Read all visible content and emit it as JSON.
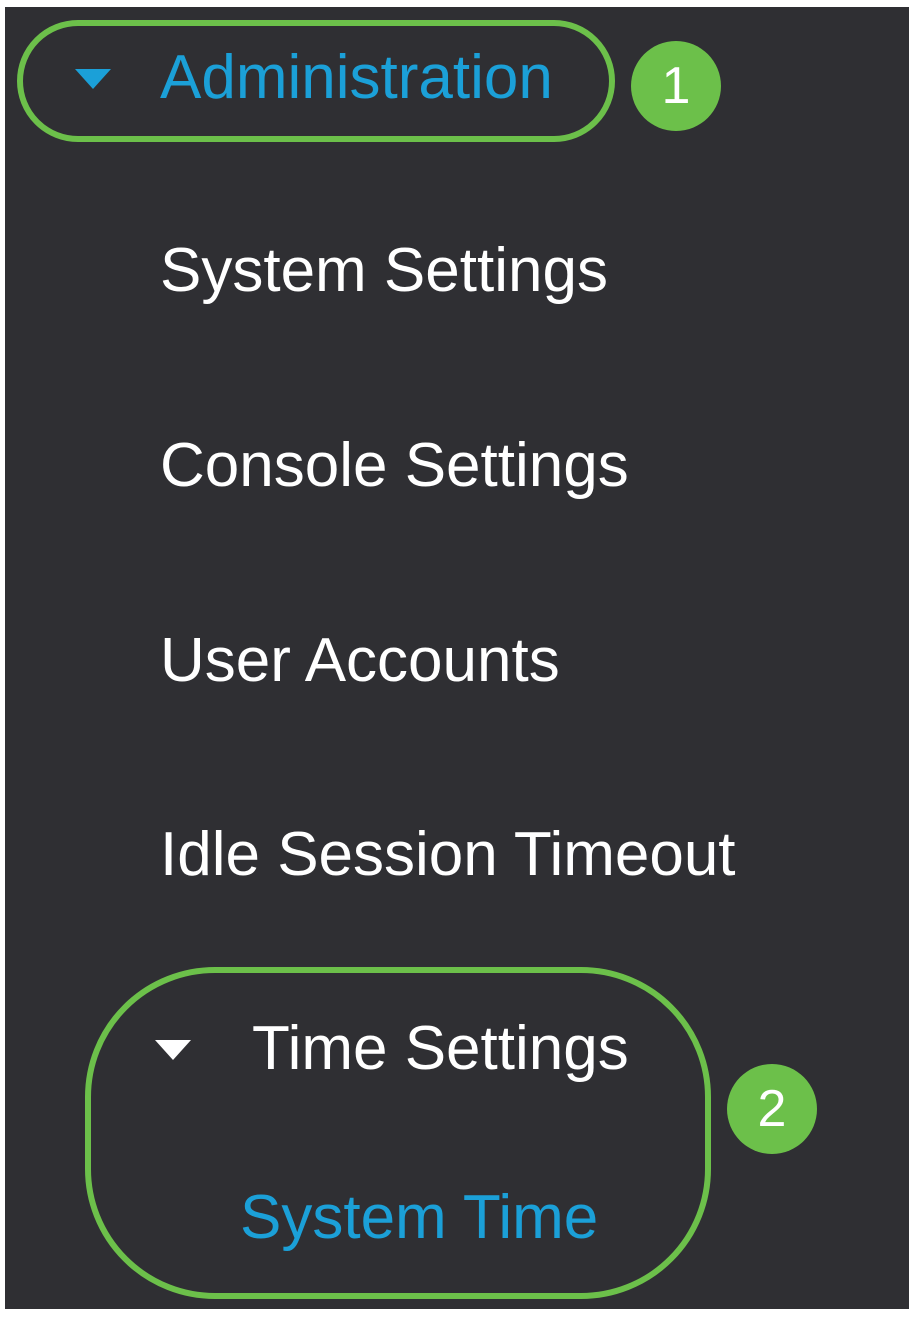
{
  "menu": {
    "administration": {
      "label": "Administration",
      "icon": "caret-down-icon",
      "color": "#1ba0d8"
    },
    "items": [
      {
        "label": "System Settings"
      },
      {
        "label": "Console Settings"
      },
      {
        "label": "User Accounts"
      },
      {
        "label": "Idle Session Timeout"
      }
    ],
    "time_settings": {
      "label": "Time Settings",
      "icon": "caret-down-icon"
    },
    "system_time": {
      "label": "System Time",
      "color": "#1ba0d8"
    }
  },
  "callouts": [
    {
      "number": "1",
      "color": "#6cc04a"
    },
    {
      "number": "2",
      "color": "#6cc04a"
    }
  ],
  "colors": {
    "panel_background": "#2f2f33",
    "text": "#ffffff",
    "accent": "#1ba0d8",
    "highlight": "#6cc04a"
  }
}
